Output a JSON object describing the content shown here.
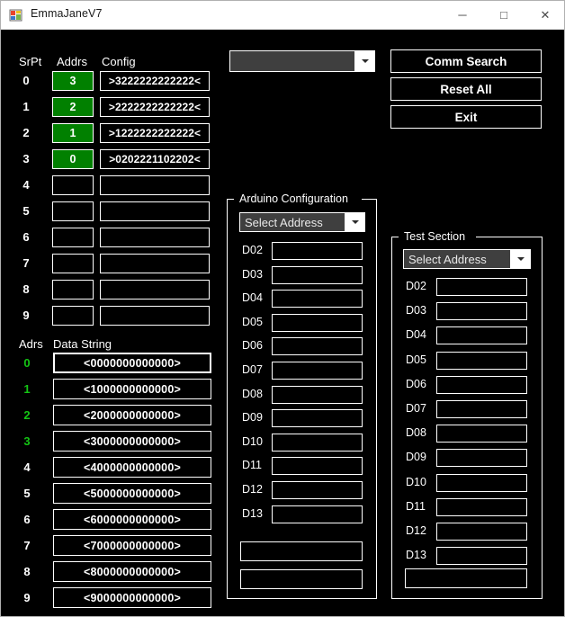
{
  "window": {
    "title": "EmmaJaneV7",
    "icon": "app-form-icon",
    "minimize_label": "─",
    "maximize_label": "□",
    "close_label": "✕"
  },
  "serial_points": {
    "headers": {
      "srpt": "SrPt",
      "addrs": "Addrs",
      "config": "Config"
    },
    "rows": [
      {
        "srpt": "0",
        "addr": "3",
        "config": ">3222222222222<",
        "filled": true
      },
      {
        "srpt": "1",
        "addr": "2",
        "config": ">2222222222222<",
        "filled": true
      },
      {
        "srpt": "2",
        "addr": "1",
        "config": ">1222222222222<",
        "filled": true
      },
      {
        "srpt": "3",
        "addr": "0",
        "config": ">0202221102202<",
        "filled": true
      },
      {
        "srpt": "4",
        "addr": "",
        "config": "",
        "filled": false
      },
      {
        "srpt": "5",
        "addr": "",
        "config": "",
        "filled": false
      },
      {
        "srpt": "6",
        "addr": "",
        "config": "",
        "filled": false
      },
      {
        "srpt": "7",
        "addr": "",
        "config": "",
        "filled": false
      },
      {
        "srpt": "8",
        "addr": "",
        "config": "",
        "filled": false
      },
      {
        "srpt": "9",
        "addr": "",
        "config": "",
        "filled": false
      }
    ]
  },
  "data_strings": {
    "headers": {
      "adrs": "Adrs",
      "data": "Data String"
    },
    "rows": [
      {
        "adrs": "0",
        "value": "<0000000000000>",
        "label_green": true
      },
      {
        "adrs": "1",
        "value": "<1000000000000>",
        "label_green": true
      },
      {
        "adrs": "2",
        "value": "<2000000000000>",
        "label_green": true
      },
      {
        "adrs": "3",
        "value": "<3000000000000>",
        "label_green": true
      },
      {
        "adrs": "4",
        "value": "<4000000000000>",
        "label_green": false
      },
      {
        "adrs": "5",
        "value": "<5000000000000>",
        "label_green": false
      },
      {
        "adrs": "6",
        "value": "<6000000000000>",
        "label_green": false
      },
      {
        "adrs": "7",
        "value": "<7000000000000>",
        "label_green": false
      },
      {
        "adrs": "8",
        "value": "<8000000000000>",
        "label_green": false
      },
      {
        "adrs": "9",
        "value": "<9000000000000>",
        "label_green": false
      }
    ]
  },
  "port_combo": {
    "value": "",
    "placeholder": ""
  },
  "buttons": {
    "comm_search": "Comm Search",
    "reset_all": "Reset All",
    "exit": "Exit"
  },
  "arduino_configuration": {
    "title": "Arduino Configuration",
    "address_combo": {
      "value": "Select Address"
    },
    "pins": [
      {
        "label": "D02",
        "value": ""
      },
      {
        "label": "D03",
        "value": ""
      },
      {
        "label": "D04",
        "value": ""
      },
      {
        "label": "D05",
        "value": ""
      },
      {
        "label": "D06",
        "value": ""
      },
      {
        "label": "D07",
        "value": ""
      },
      {
        "label": "D08",
        "value": ""
      },
      {
        "label": "D09",
        "value": ""
      },
      {
        "label": "D10",
        "value": ""
      },
      {
        "label": "D11",
        "value": ""
      },
      {
        "label": "D12",
        "value": ""
      },
      {
        "label": "D13",
        "value": ""
      }
    ],
    "extra_fields": [
      {
        "value": ""
      },
      {
        "value": ""
      }
    ]
  },
  "test_section": {
    "title": "Test Section",
    "address_combo": {
      "value": "Select Address"
    },
    "pins": [
      {
        "label": "D02",
        "value": ""
      },
      {
        "label": "D03",
        "value": ""
      },
      {
        "label": "D04",
        "value": ""
      },
      {
        "label": "D05",
        "value": ""
      },
      {
        "label": "D06",
        "value": ""
      },
      {
        "label": "D07",
        "value": ""
      },
      {
        "label": "D08",
        "value": ""
      },
      {
        "label": "D09",
        "value": ""
      },
      {
        "label": "D10",
        "value": ""
      },
      {
        "label": "D11",
        "value": ""
      },
      {
        "label": "D12",
        "value": ""
      },
      {
        "label": "D13",
        "value": ""
      }
    ],
    "extra_fields": [
      {
        "value": ""
      }
    ]
  },
  "colors": {
    "background": "#000000",
    "foreground": "#ffffff",
    "addr_green": "#018000",
    "label_green": "#14c414",
    "combo_fill": "#3f3f3f",
    "titlebar": "#ffffff"
  }
}
